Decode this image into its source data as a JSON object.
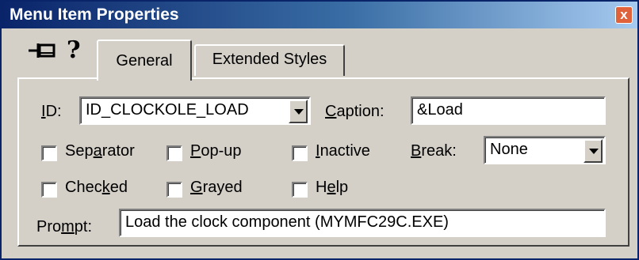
{
  "window": {
    "title": "Menu Item Properties",
    "close_label": "x"
  },
  "toolbar": {
    "pin": "pin-icon",
    "help": "?"
  },
  "tabs": [
    {
      "label": "General",
      "active": true
    },
    {
      "label": "Extended Styles",
      "active": false
    }
  ],
  "form": {
    "id": {
      "label": "ID:",
      "value": "ID_CLOCKOLE_LOAD"
    },
    "caption": {
      "label": "Caption:",
      "value": "&Load"
    },
    "break": {
      "label": "Break:",
      "value": "None"
    },
    "checkboxes": [
      {
        "label": "Separator",
        "checked": false
      },
      {
        "label": "Pop-up",
        "checked": false
      },
      {
        "label": "Inactive",
        "checked": false
      },
      {
        "label": "Checked",
        "checked": false
      },
      {
        "label": "Grayed",
        "checked": false
      },
      {
        "label": "Help",
        "checked": false
      }
    ],
    "prompt": {
      "label": "Prompt:",
      "value": "Load the clock component (MYMFC29C.EXE)"
    }
  }
}
